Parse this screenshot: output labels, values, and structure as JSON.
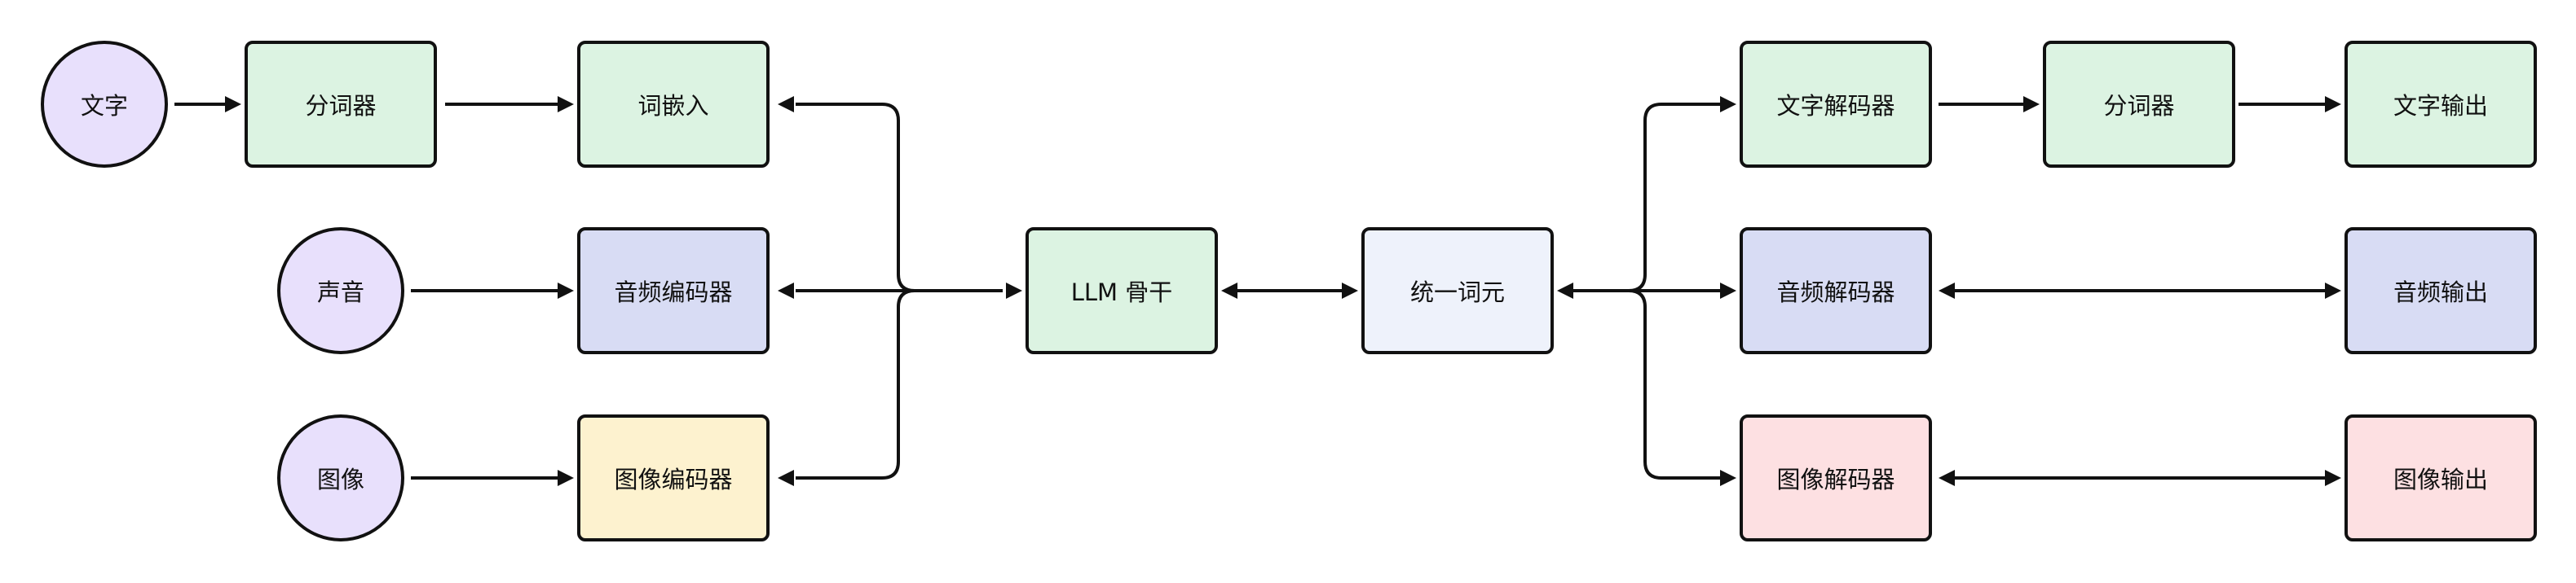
{
  "nodes": {
    "input_text": "文字",
    "tokenizer_in": "分词器",
    "word_embedding": "词嵌入",
    "input_audio": "声音",
    "audio_encoder": "音频编码器",
    "input_image": "图像",
    "image_encoder": "图像编码器",
    "llm_backbone": "LLM 骨干",
    "unified_tokens": "统一词元",
    "text_decoder": "文字解码器",
    "tokenizer_out": "分词器",
    "text_output": "文字输出",
    "audio_decoder": "音频解码器",
    "audio_output": "音频输出",
    "image_decoder": "图像解码器",
    "image_output": "图像输出"
  },
  "colors": {
    "input_circle": "#e8e0fc",
    "green": "#dcf3e2",
    "blue": "#d8dcf4",
    "yellow": "#fdf2cf",
    "pink": "#fde0e2",
    "pale": "#eef2fb",
    "stroke": "#111111"
  }
}
